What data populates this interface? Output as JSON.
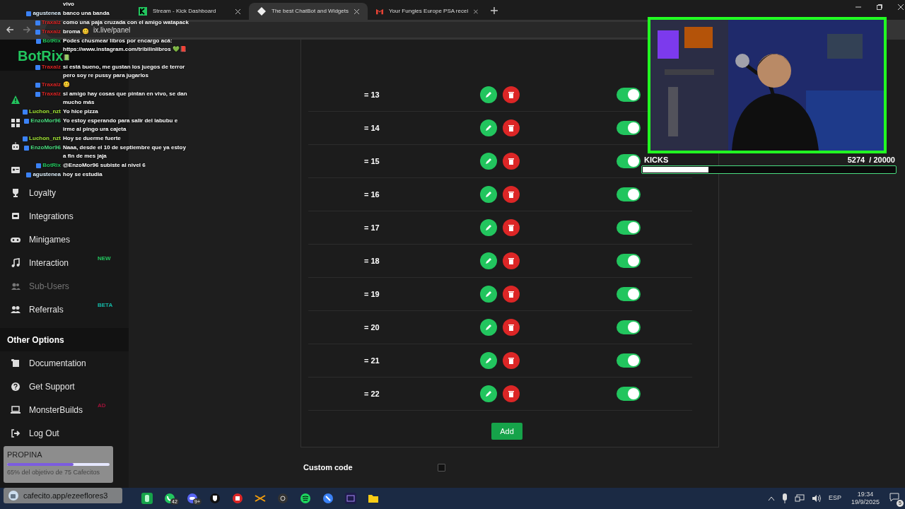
{
  "browser": {
    "tabs": [
      {
        "title": "Stream - Kick Dashboard",
        "selected": false
      },
      {
        "title": "The best ChatBot and Widgets",
        "selected": true
      },
      {
        "title": "Your Fungies Europe PSA recei",
        "selected": false
      }
    ],
    "address": "ix.live/panel"
  },
  "logo": "BotRix",
  "sidebar": {
    "items": [
      {
        "disabled": false
      },
      {
        "disabled": false
      },
      {
        "disabled": false
      },
      {
        "disabled": false
      },
      {
        "label": "Loyalty",
        "disabled": false
      },
      {
        "label": "Integrations",
        "disabled": false
      },
      {
        "label": "Minigames",
        "disabled": false
      },
      {
        "label": "Interaction",
        "disabled": false,
        "badge": "NEW",
        "color": "#22c55e"
      },
      {
        "label": "Sub-Users",
        "disabled": true
      },
      {
        "label": "Referrals",
        "disabled": false,
        "badge": "BETA",
        "color": "#14b8a6"
      }
    ],
    "section": "Other Options",
    "other_items": [
      {
        "label": "Documentation"
      },
      {
        "label": "Get Support"
      },
      {
        "label": "MonsterBuilds",
        "badge": "AD",
        "color": "#9f1239"
      },
      {
        "label": "Log Out"
      }
    ]
  },
  "rows": [
    {
      "label": "= 13",
      "on": true
    },
    {
      "label": "= 14",
      "on": true
    },
    {
      "label": "= 15",
      "on": true
    },
    {
      "label": "= 16",
      "on": true
    },
    {
      "label": "= 17",
      "on": true
    },
    {
      "label": "= 18",
      "on": true
    },
    {
      "label": "= 19",
      "on": true
    },
    {
      "label": "= 20",
      "on": true
    },
    {
      "label": "= 21",
      "on": true
    },
    {
      "label": "= 22",
      "on": true
    }
  ],
  "add_button": "Add",
  "custom_code": {
    "label": "Custom code",
    "checked": false
  },
  "chat": {
    "messages": [
      {
        "text": "vivo"
      },
      {
        "user": "agustenea",
        "color": "#e0f2fe",
        "text": "banco una banda"
      },
      {
        "user": "Traxalz",
        "color": "#dc2626",
        "text": "como una paja cruzada con el amigo watapack"
      },
      {
        "user": "Traxalz",
        "color": "#dc2626",
        "text": "broma 🥴"
      },
      {
        "user": "BotRix",
        "color": "#22c55e",
        "text": "Podes chusmear libros por encargo acá: https://www.instagram.com/tribilinlibros 💚📕📗"
      },
      {
        "user": "Traxalz",
        "color": "#dc2626",
        "text": "sí está bueno, me gustan los juegos de terror pero soy re pussy para jugarlos"
      },
      {
        "user": "Traxalz",
        "color": "#dc2626",
        "text": "🥴"
      },
      {
        "user": "Traxalz",
        "color": "#dc2626",
        "text": "si amigo hay cosas que pintan en vivo, se dan mucho más"
      },
      {
        "user": "Luchon_nzt",
        "color": "#a3e635",
        "text": "Yo hice pizza"
      },
      {
        "user": "EnzoMor96",
        "color": "#4ade80",
        "text": "Yo estoy esperando para salir del labubu e irme al pingo ura cajeta"
      },
      {
        "user": "Luchon_nzt",
        "color": "#a3e635",
        "text": "Hoy se duerme fuerte"
      },
      {
        "user": "EnzoMor96",
        "color": "#4ade80",
        "text": "Naaa, desde el 10 de septiembre que ya estoy a fin de mes jaja"
      },
      {
        "user": "BotRix",
        "color": "#22c55e",
        "text": "@EnzoMor96 subiste al nivel 6"
      },
      {
        "user": "agustenea",
        "color": "#e0f2fe",
        "text": "hoy se estudia"
      }
    ]
  },
  "kicks": {
    "label": "KICKS",
    "reading": "5274  / 20000",
    "level": 0.26
  },
  "propina": {
    "title": "PROPINA",
    "level": 0.65,
    "caption": "65% del objetivo de 75 Cafecitos"
  },
  "cafecito": "cafecito.app/ezeeflores3",
  "taskbar": {
    "badges": [
      "42",
      "9+"
    ],
    "language": "ESP",
    "time": "19:34",
    "date": "19/9/2025",
    "notifications": "5"
  }
}
